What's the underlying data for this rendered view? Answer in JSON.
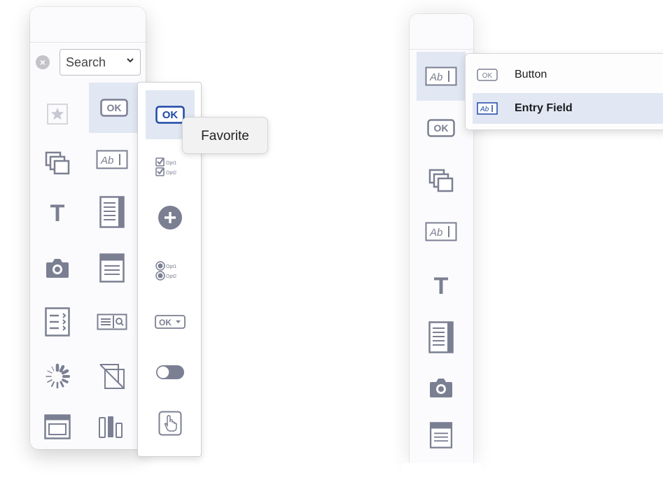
{
  "left_palette": {
    "search": {
      "value": "Search"
    },
    "cells": [
      {
        "icon": "favorite-star-icon"
      },
      {
        "icon": "ok-button-icon",
        "label": "OK",
        "selected": true
      },
      {
        "icon": "overlapping-windows-icon"
      },
      {
        "icon": "entry-field-icon",
        "label": "Ab"
      },
      {
        "icon": "text-icon",
        "label": "T"
      },
      {
        "icon": "scrolling-text-icon"
      },
      {
        "icon": "camera-icon"
      },
      {
        "icon": "list-window-icon"
      },
      {
        "icon": "disclosure-list-icon"
      },
      {
        "icon": "search-field-icon"
      },
      {
        "icon": "progress-spinner-icon"
      },
      {
        "icon": "image-placeholder-icon"
      },
      {
        "icon": "window-frame-icon"
      },
      {
        "icon": "bar-chart-icon"
      }
    ]
  },
  "controls_popup": {
    "items": [
      {
        "icon": "ok-button-icon",
        "label": "OK",
        "selected": true
      },
      {
        "icon": "checkbox-group-icon",
        "options": [
          "Opt1",
          "Opt2"
        ]
      },
      {
        "icon": "add-circle-icon"
      },
      {
        "icon": "radio-group-icon",
        "options": [
          "Opt1",
          "Opt2"
        ]
      },
      {
        "icon": "popup-button-icon",
        "label": "OK"
      },
      {
        "icon": "toggle-switch-icon"
      },
      {
        "icon": "touch-area-icon"
      }
    ],
    "tooltip": "Favorite"
  },
  "right_palette": {
    "cells": [
      {
        "icon": "entry-field-icon",
        "label": "Ab",
        "selected": true
      },
      {
        "icon": "ok-button-icon",
        "label": "OK"
      },
      {
        "icon": "overlapping-windows-icon"
      },
      {
        "icon": "entry-field-icon",
        "label": "Ab"
      },
      {
        "icon": "text-icon",
        "label": "T"
      },
      {
        "icon": "scrolling-text-icon"
      },
      {
        "icon": "camera-icon"
      },
      {
        "icon": "list-window-icon"
      }
    ]
  },
  "menu": {
    "items": [
      {
        "icon": "ok-button-icon",
        "icon_label": "OK",
        "label": "Button",
        "highlighted": false
      },
      {
        "icon": "entry-field-icon",
        "icon_label": "Ab",
        "label": "Entry Field",
        "highlighted": true
      }
    ]
  },
  "colors": {
    "icon_gray": "#7b7f92",
    "icon_blue": "#1f49a8",
    "selection": "#e1e7f3"
  }
}
